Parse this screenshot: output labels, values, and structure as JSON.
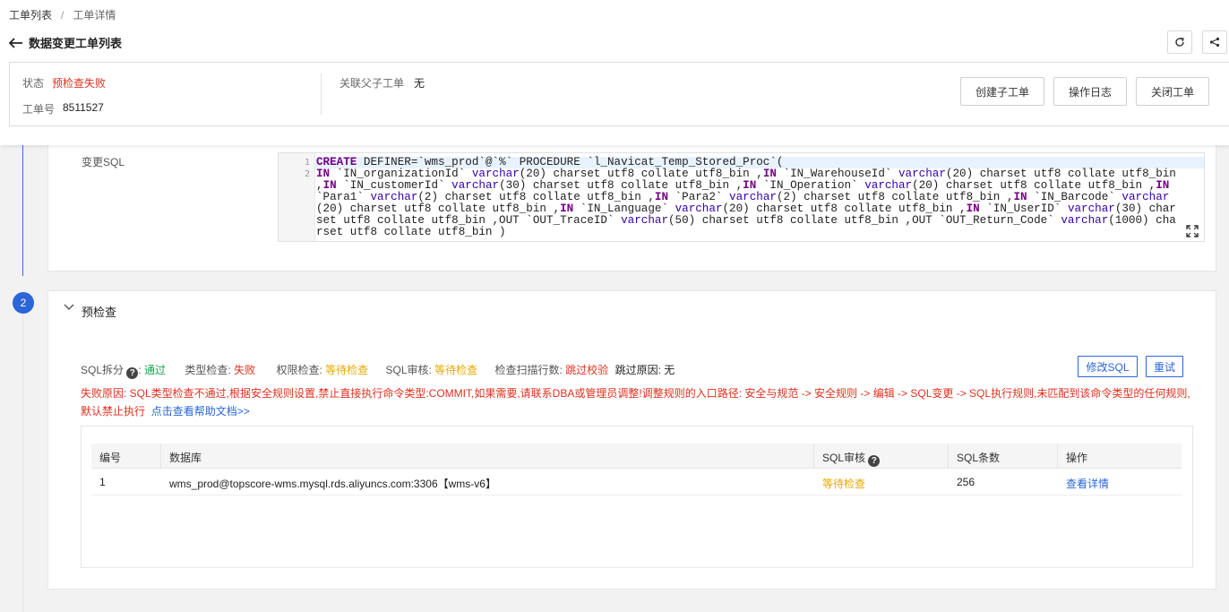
{
  "breadcrumb": {
    "items": [
      "工单列表",
      "工单详情"
    ],
    "separator": "/"
  },
  "header": {
    "title": "数据变更工单列表"
  },
  "info": {
    "status_label": "状态",
    "status_value": "预检查失败",
    "order_label": "工单号",
    "order_value": "8511527",
    "related_label": "关联父子工单",
    "related_value": "无"
  },
  "actions": {
    "create_child": "创建子工单",
    "op_log": "操作日志",
    "close": "关闭工单"
  },
  "sql_section": {
    "label": "变更SQL",
    "line_numbers": [
      "1",
      "2"
    ],
    "line1": "CREATE DEFINER=`wms_prod`@`%` PROCEDURE `l_Navicat_Temp_Stored_Proc`(",
    "tokens": [
      [
        "kw",
        "IN"
      ],
      [
        "t",
        " `IN_organizationId` "
      ],
      [
        "ty",
        "varchar"
      ],
      [
        "t",
        "(20) charset utf8 collate utf8_bin ,"
      ],
      [
        "kw",
        "IN"
      ],
      [
        "t",
        " `IN_WarehouseId` "
      ],
      [
        "ty",
        "varchar"
      ],
      [
        "t",
        "(20) charset utf8 collate utf8_bin ,"
      ],
      [
        "kw",
        "IN"
      ],
      [
        "t",
        " `IN_customerId` "
      ],
      [
        "ty",
        "varchar"
      ],
      [
        "t",
        "(30) charset utf8 collate utf8_bin ,"
      ],
      [
        "kw",
        "IN"
      ],
      [
        "t",
        " `IN_Operation` "
      ],
      [
        "ty",
        "varchar"
      ],
      [
        "t",
        "(20) charset utf8 collate utf8_bin ,"
      ],
      [
        "kw",
        "IN"
      ],
      [
        "t",
        " `Para1` "
      ],
      [
        "ty",
        "varchar"
      ],
      [
        "t",
        "(2) charset utf8 collate utf8_bin ,"
      ],
      [
        "kw",
        "IN"
      ],
      [
        "t",
        " `Para2` "
      ],
      [
        "ty",
        "varchar"
      ],
      [
        "t",
        "(2) charset utf8 collate utf8_bin ,"
      ],
      [
        "kw",
        "IN"
      ],
      [
        "t",
        " `IN_Barcode` "
      ],
      [
        "ty",
        "varchar"
      ],
      [
        "t",
        "(20) charset utf8 collate utf8_bin ,"
      ],
      [
        "kw",
        "IN"
      ],
      [
        "t",
        " `IN_Language` "
      ],
      [
        "ty",
        "varchar"
      ],
      [
        "t",
        "(20) charset utf8 collate utf8_bin ,"
      ],
      [
        "kw",
        "IN"
      ],
      [
        "t",
        " `IN_UserID` "
      ],
      [
        "ty",
        "varchar"
      ],
      [
        "t",
        "(30) charset utf8 collate utf8_bin ,OUT `OUT_TraceID` "
      ],
      [
        "ty",
        "varchar"
      ],
      [
        "t",
        "(50) charset utf8 collate utf8_bin ,OUT `OUT_Return_Code` "
      ],
      [
        "ty",
        "varchar"
      ],
      [
        "t",
        "(1000) charset utf8 collate utf8_bin )"
      ]
    ]
  },
  "precheck": {
    "step_number": "2",
    "title": "预检查",
    "items": [
      {
        "label": "SQL拆分",
        "value": "通过",
        "color": "#1aa34a",
        "has_help": true
      },
      {
        "label": "类型检查",
        "value": "失败",
        "color": "#e0301e",
        "has_help": false
      },
      {
        "label": "权限检查",
        "value": "等待检查",
        "color": "#e8a800",
        "has_help": false
      },
      {
        "label": "SQL审核",
        "value": "等待检查",
        "color": "#e8a800",
        "has_help": false
      },
      {
        "label": "检查扫描行数",
        "value": "跳过校验",
        "color": "#e0301e",
        "has_help": false
      }
    ],
    "skip_reason_label": "跳过原因:",
    "skip_reason_value": "无",
    "modify_sql": "修改SQL",
    "retry": "重试",
    "fail_reason": "失败原因:  SQL类型检查不通过,根据安全规则设置,禁止直接执行命令类型:COMMIT,如果需要,请联系DBA或管理员调整!调整规则的入口路径:  安全与规范 -> 安全规则 -> 编辑 -> SQL变更 -> SQL执行规则,未匹配到该命令类型的任何规则,默认禁止执行",
    "help_link": "点击查看帮助文档>>"
  },
  "table": {
    "headers": {
      "no": "编号",
      "db": "数据库",
      "audit": "SQL审核",
      "count": "SQL条数",
      "op": "操作"
    },
    "rows": [
      {
        "no": "1",
        "db": "wms_prod@topscore-wms.mysql.rds.aliyuncs.com:3306【wms-v6】",
        "audit": "等待检查",
        "count": "256",
        "op": "查看详情"
      }
    ]
  },
  "colors": {
    "accent": "#2a66d8",
    "danger": "#e0301e",
    "success": "#1aa34a",
    "warning": "#e8a800"
  }
}
